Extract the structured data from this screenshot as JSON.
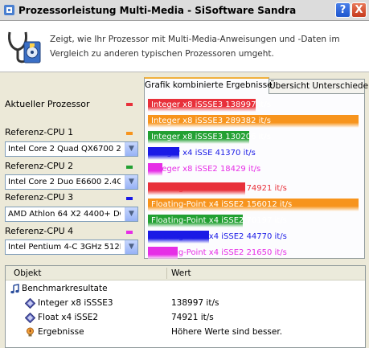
{
  "window": {
    "title": "Prozessorleistung Multi-Media - SiSoftware Sandra",
    "help_label": "?",
    "close_label": "X"
  },
  "header": {
    "description": "Zeigt, wie Ihr Prozessor mit Multi-Media-Anweisungen und -Daten im Vergleich zu anderen typischen Prozessoren umgeht."
  },
  "left": {
    "current_label": "Aktueller Prozessor",
    "refs": [
      {
        "label": "Referenz-CPU 1",
        "value": "Intel Core 2 Quad QX6700 2.66",
        "color": "#f7941d"
      },
      {
        "label": "Referenz-CPU 2",
        "value": "Intel Core 2 Duo E6600 2.4GHz",
        "color": "#22a032"
      },
      {
        "label": "Referenz-CPU 3",
        "value": "AMD Athlon 64 X2 4400+ DC",
        "color": "#1a1ae6"
      },
      {
        "label": "Referenz-CPU 4",
        "value": "Intel Pentium 4-C 3GHz 512L2",
        "color": "#e62ee6"
      }
    ],
    "current_color": "#e8303a",
    "dropdown_icon": "chevron-down-icon"
  },
  "tabs": [
    {
      "label": "Grafik kombinierte Ergebnisse"
    },
    {
      "label": "Übersicht Unterschiede"
    }
  ],
  "bars": [
    {
      "text": "Integer x8 iSSSE3 138997 it/s",
      "color": "#e8303a",
      "text_color": "#ffffff",
      "fraction": 0.51
    },
    {
      "text": "Integer x8 iSSSE3 289382 it/s",
      "color": "#f7941d",
      "text_color": "#ffffff",
      "fraction": 1.0
    },
    {
      "text": "Integer x8 iSSSE3 130206 it/s",
      "color": "#22a032",
      "text_color": "#ffffff",
      "fraction": 0.48
    },
    {
      "text": "Integer x4 iSSE 41370 it/s",
      "color": "#1a1ae6",
      "text_color": "#1a1ae6",
      "fraction": 0.15
    },
    {
      "text": "Integer x8 iSSE2 18429 it/s",
      "color": "#e62ee6",
      "text_color": "#e62ee6",
      "fraction": 0.07
    },
    {
      "text": "Floating-Point x4 iSSE2 74921 it/s",
      "color": "#e8303a",
      "text_color": "#e8303a",
      "fraction": 0.46
    },
    {
      "text": "Floating-Point x4 iSSE2 156012 it/s",
      "color": "#f7941d",
      "text_color": "#ffffff",
      "fraction": 1.0
    },
    {
      "text": "Floating-Point x4 iSSE2 70197 it/s",
      "color": "#22a032",
      "text_color": "#ffffff",
      "fraction": 0.45
    },
    {
      "text": "Floating-Point x4 iSSE2 44770 it/s",
      "color": "#1a1ae6",
      "text_color": "#1a1ae6",
      "fraction": 0.29
    },
    {
      "text": "Floating-Point x4 iSSE2 21650 it/s",
      "color": "#e62ee6",
      "text_color": "#e62ee6",
      "fraction": 0.14
    }
  ],
  "list": {
    "col_object": "Objekt",
    "col_value": "Wert",
    "group": "Benchmarkresultate",
    "rows": [
      {
        "key": "Integer x8 iSSSE3",
        "value": "138997 it/s",
        "icon": "diamond-icon"
      },
      {
        "key": "Float x4 iSSE2",
        "value": "74921 it/s",
        "icon": "diamond-icon"
      },
      {
        "key": "Ergebnisse",
        "value": "Höhere Werte sind besser.",
        "icon": "info-bulb-icon"
      }
    ]
  }
}
